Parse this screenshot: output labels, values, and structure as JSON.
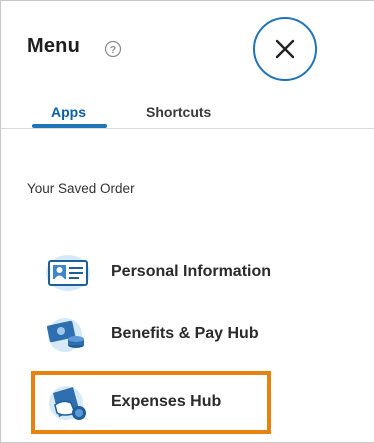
{
  "menu": {
    "title": "Menu",
    "help_icon": "question-circle-icon",
    "close_icon": "close-x-icon"
  },
  "tabs": [
    {
      "label": "Apps",
      "active": true
    },
    {
      "label": "Shortcuts",
      "active": false
    }
  ],
  "section": {
    "label": "Your Saved Order"
  },
  "apps": [
    {
      "label": "Personal Information",
      "icon": "id-card-icon"
    },
    {
      "label": "Benefits & Pay Hub",
      "icon": "money-coins-icon"
    },
    {
      "label": "Expenses Hub",
      "icon": "hand-coin-icon",
      "highlighted": true
    }
  ],
  "colors": {
    "accent": "#1f73b7",
    "highlight": "#e8820e",
    "icon_bg": "#d6e9f8"
  }
}
